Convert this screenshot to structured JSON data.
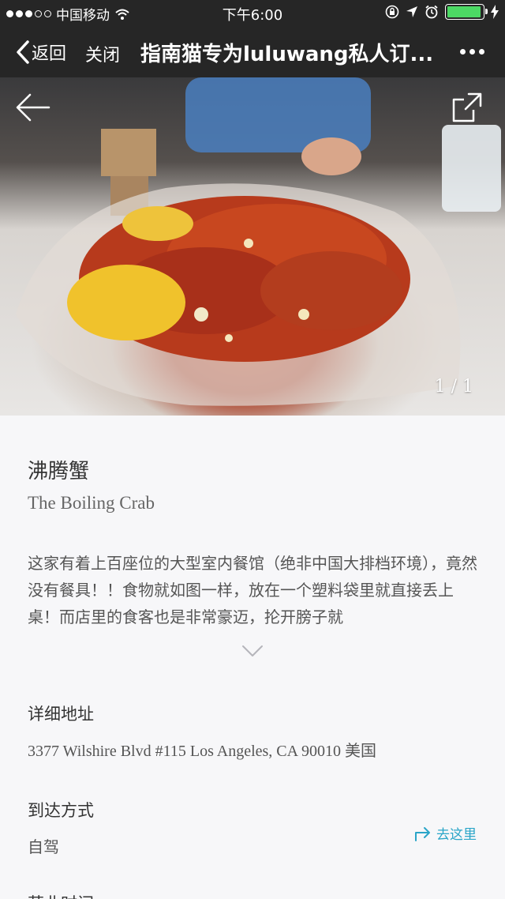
{
  "status_bar": {
    "carrier": "中国移动",
    "time": "下午6:00",
    "battery_level": 0.95,
    "icons": [
      "wifi-icon",
      "rotation-lock-icon",
      "location-icon",
      "alarm-icon",
      "battery-icon",
      "charging-icon"
    ]
  },
  "nav": {
    "back_label": "返回",
    "close_label": "关闭",
    "title": "指南猫专为luluwang私人订..."
  },
  "hero": {
    "image_alt": "",
    "counter": "1 / 1"
  },
  "place": {
    "name_cn": "沸腾蟹",
    "name_en": "The Boiling Crab",
    "description": "这家有着上百座位的大型室内餐馆（绝非中国大排档环境），竟然没有餐具！！食物就如图一样，放在一个塑料袋里就直接丢上桌！而店里的食客也是非常豪迈，抡开膀子就"
  },
  "address": {
    "label": "详细地址",
    "value": "3377 Wilshire Blvd #115 Los Angeles, CA 90010 美国"
  },
  "arrival": {
    "label": "到达方式",
    "value": "自驾",
    "goto_label": "去这里"
  },
  "hours": {
    "label": "营业时间"
  },
  "colors": {
    "bar_bg": "#262626",
    "accent": "#2aa5c8",
    "battery": "#4cd964"
  }
}
